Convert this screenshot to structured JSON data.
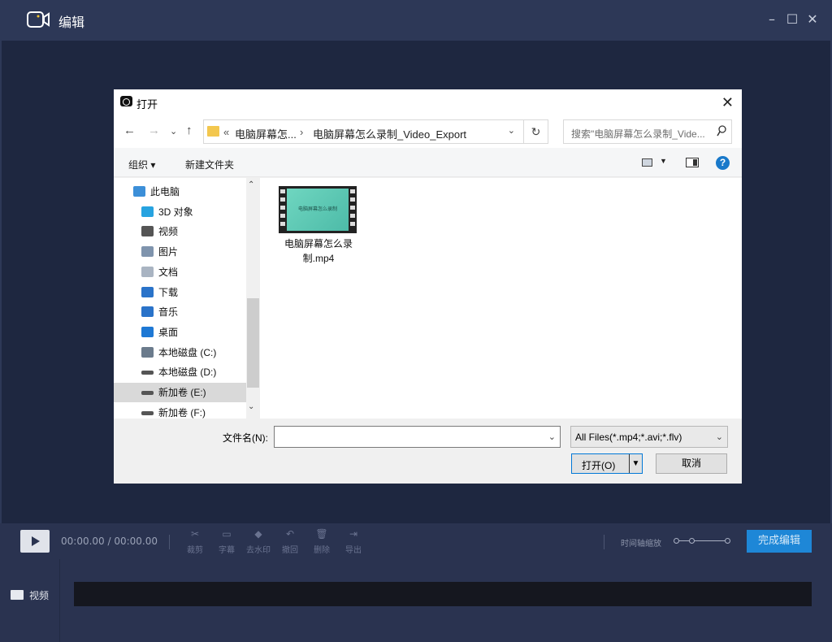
{
  "app": {
    "title": "编辑",
    "window_controls": [
      "–",
      "☐",
      "✕"
    ]
  },
  "dialog": {
    "title": "打开",
    "close": "✕",
    "nav": {
      "back": "←",
      "forward": "→",
      "recent": "⌄",
      "up": "↑"
    },
    "address": {
      "chevron": "«",
      "crumbs": [
        "电脑屏幕怎...",
        "电脑屏幕怎么录制_Video_Export"
      ],
      "separator": "›",
      "dropdown": "⌄",
      "refresh": "↻"
    },
    "search": {
      "placeholder": "搜索\"电脑屏幕怎么录制_Vide...",
      "icon": "search-icon"
    },
    "toolbar": {
      "organize": "组织 ▾",
      "new_folder": "新建文件夹",
      "help": "?"
    },
    "tree": [
      {
        "label": "此电脑",
        "icon": "computer-icon",
        "color": "#3c8fd8"
      },
      {
        "label": "3D 对象",
        "icon": "cube-icon",
        "color": "#27a3e0"
      },
      {
        "label": "视频",
        "icon": "film-icon",
        "color": "#555555"
      },
      {
        "label": "图片",
        "icon": "picture-icon",
        "color": "#7f94ad"
      },
      {
        "label": "文档",
        "icon": "document-icon",
        "color": "#a9b4c2"
      },
      {
        "label": "下载",
        "icon": "download-icon",
        "color": "#2a73c9"
      },
      {
        "label": "音乐",
        "icon": "music-icon",
        "color": "#2a73c9"
      },
      {
        "label": "桌面",
        "icon": "desktop-icon",
        "color": "#1e78d4"
      },
      {
        "label": "本地磁盘 (C:)",
        "icon": "drive-c-icon",
        "color": "#6b7b8c"
      },
      {
        "label": "本地磁盘 (D:)",
        "icon": "drive-icon",
        "color": "#555555"
      },
      {
        "label": "新加卷 (E:)",
        "icon": "drive-icon",
        "color": "#555555",
        "selected": true
      },
      {
        "label": "新加卷 (F:)",
        "icon": "drive-icon",
        "color": "#555555"
      }
    ],
    "scroll": {
      "up": "⌃",
      "down": "⌄"
    },
    "files": [
      {
        "name_line1": "电脑屏幕怎么录",
        "name_line2": "制.mp4",
        "thumb_text": "电脑屏幕怎么录制"
      }
    ],
    "filename_label": "文件名(N):",
    "filename_value": "",
    "filename_dropdown": "⌄",
    "filter": "All Files(*.mp4;*.avi;*.flv)",
    "filter_dropdown": "⌄",
    "open_button": "打开(O)",
    "open_split": "▼",
    "cancel_button": "取消"
  },
  "controls": {
    "time": "00:00.00 / 00:00.00",
    "tools": [
      {
        "label": "裁剪",
        "icon": "scissors-icon",
        "glyph": "✂"
      },
      {
        "label": "字幕",
        "icon": "subtitle-icon",
        "glyph": "▭"
      },
      {
        "label": "去水印",
        "icon": "eraser-icon",
        "glyph": "◆"
      },
      {
        "label": "撤回",
        "icon": "undo-icon",
        "glyph": "↶"
      },
      {
        "label": "删除",
        "icon": "trash-icon",
        "glyph": "🗑"
      },
      {
        "label": "导出",
        "icon": "export-icon",
        "glyph": "⇥"
      }
    ],
    "zoom_label": "时间轴缩放",
    "finish": "完成编辑"
  },
  "track": {
    "label": "视频"
  }
}
